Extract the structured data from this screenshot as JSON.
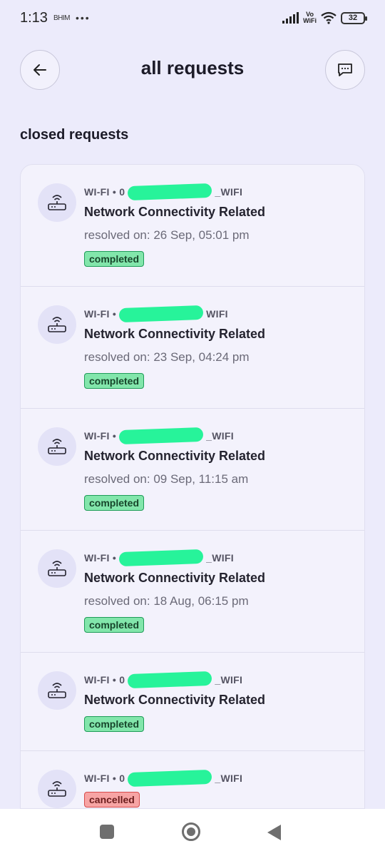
{
  "status_bar": {
    "time": "1:13",
    "app_indicator": "BHIM",
    "dots": "•••",
    "network_label_top": "Vo",
    "network_label_bottom": "WiFi",
    "battery": "32"
  },
  "header": {
    "title": "all requests",
    "back_icon": "arrow-left-icon",
    "chat_icon": "chat-bubble-icon"
  },
  "section": {
    "title": "closed requests"
  },
  "requests": [
    {
      "meta_prefix": "WI-FI • 0",
      "meta_suffix": "_WIFI",
      "title": "Network Connectivity Related",
      "resolved": "resolved on: 26 Sep, 05:01 pm",
      "status": "completed"
    },
    {
      "meta_prefix": "WI-FI •",
      "meta_suffix": "WIFI",
      "title": "Network Connectivity Related",
      "resolved": "resolved on: 23 Sep, 04:24 pm",
      "status": "completed"
    },
    {
      "meta_prefix": "WI-FI •",
      "meta_suffix": "_WIFI",
      "title": "Network Connectivity Related",
      "resolved": "resolved on: 09 Sep, 11:15 am",
      "status": "completed"
    },
    {
      "meta_prefix": "WI-FI •",
      "meta_suffix": "_WIFI",
      "title": "Network Connectivity Related",
      "resolved": "resolved on: 18 Aug, 06:15 pm",
      "status": "completed"
    },
    {
      "meta_prefix": "WI-FI • 0",
      "meta_suffix": "_WIFI",
      "title": "Network Connectivity Related",
      "resolved": "",
      "status": "completed"
    },
    {
      "meta_prefix": "WI-FI • 0",
      "meta_suffix": "_WIFI",
      "title": "",
      "resolved": "",
      "status": "cancelled"
    }
  ],
  "colors": {
    "background": "#ecebfb",
    "redaction": "#27f39a",
    "completed_bg": "#82e6ab",
    "cancelled_bg": "#f7a4a4"
  }
}
